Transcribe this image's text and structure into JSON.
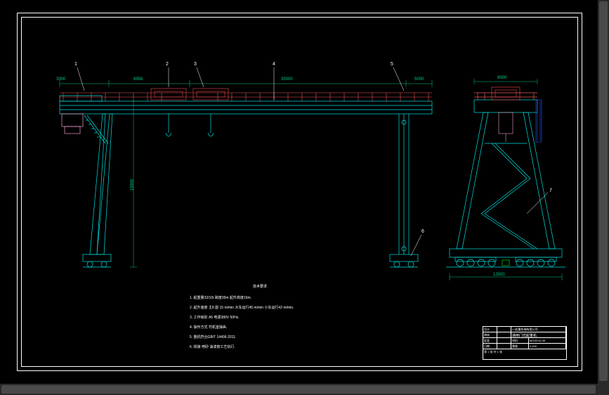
{
  "drawing": {
    "type": "gantry_crane_general_assembly",
    "views": [
      "front_elevation",
      "side_elevation"
    ]
  },
  "balloons": {
    "b1": "1",
    "b2": "2",
    "b3": "3",
    "b4": "4",
    "b5": "5",
    "b6": "6",
    "b7": "7"
  },
  "dimensions": {
    "left_cantilever": "3900",
    "span_left": "6956",
    "span_main": "35000",
    "right_cantilever": "5000",
    "height": "15900",
    "side_width": "8500",
    "side_track": "12500"
  },
  "tech_req": {
    "title": "技术要求",
    "line1": "1. 起重量32/10t 跨度35m 起升高度16m.",
    "line2": "2. 起升速度 主8  副 15 m/min 大车运行45 m/min 小车运行42 m/min.",
    "line3": "3. 工作级别 A5 电源380V 50Hz.",
    "line4": "4. 操作方式 司机室操纵.",
    "line5": "5. 整机符合GB/T 14406-2011.",
    "line6": "6. 焊接 喷砂 油漆按工艺执行."
  },
  "title_block": {
    "company": "××起重机械有限公司",
    "title": "通用门式起重机",
    "drawing_no": "MG32/10-35",
    "scale": "1:100",
    "sheet": "第 1 张 共 1 张",
    "design": "设计",
    "check": "审核",
    "approve": "批准",
    "date": "日期",
    "weight": "重量",
    "material": "材料"
  }
}
